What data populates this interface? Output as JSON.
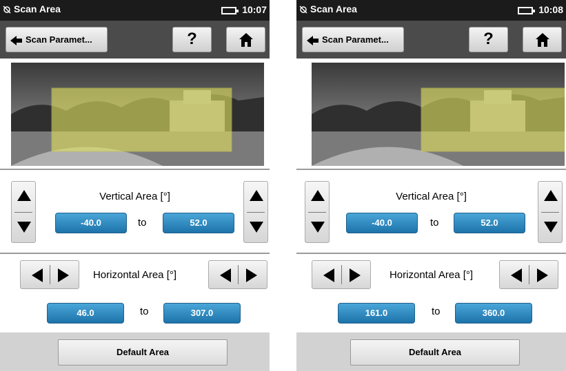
{
  "screens": [
    {
      "status": {
        "title": "Scan Area",
        "time": "10:07"
      },
      "toolbar": {
        "back_label": "Scan Paramet...",
        "help_label": "?"
      },
      "vertical": {
        "label": "Vertical Area [°]",
        "from": "-40.0",
        "to": "52.0",
        "to_word": "to"
      },
      "horizontal": {
        "label": "Horizontal Area [°]",
        "from": "46.0",
        "to": "307.0",
        "to_word": "to"
      },
      "default_label": "Default Area"
    },
    {
      "status": {
        "title": "Scan Area",
        "time": "10:08"
      },
      "toolbar": {
        "back_label": "Scan Paramet...",
        "help_label": "?"
      },
      "vertical": {
        "label": "Vertical Area [°]",
        "from": "-40.0",
        "to": "52.0",
        "to_word": "to"
      },
      "horizontal": {
        "label": "Horizontal Area [°]",
        "from": "161.0",
        "to": "360.0",
        "to_word": "to"
      },
      "default_label": "Default Area"
    }
  ],
  "colors": {
    "selection": "#dede66",
    "value_button": "#2b8ac4",
    "status_bar": "#1b1b1b",
    "toolbar": "#4b4b4b"
  },
  "icons": [
    "scan-icon",
    "battery-icon",
    "back-arrow-icon",
    "help-icon",
    "home-icon",
    "arrow-up-icon",
    "arrow-down-icon",
    "arrow-left-icon",
    "arrow-right-icon"
  ]
}
